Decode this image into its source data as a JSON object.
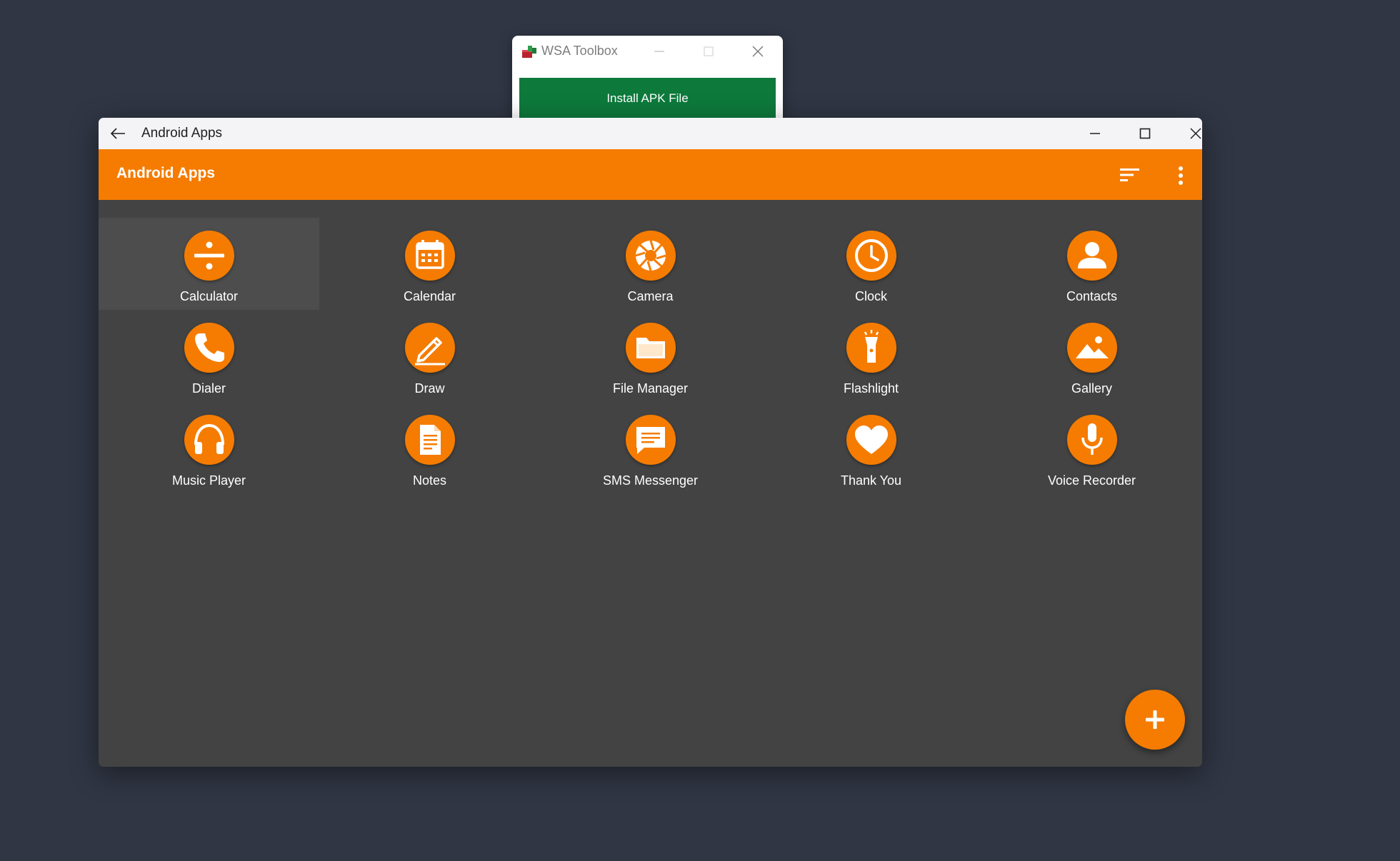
{
  "wsa_toolbox": {
    "title": "WSA Toolbox",
    "install_button": "Install APK File"
  },
  "window": {
    "title": "Android Apps"
  },
  "appbar": {
    "title": "Android Apps"
  },
  "apps": [
    {
      "label": "Calculator",
      "icon": "calculator-icon"
    },
    {
      "label": "Calendar",
      "icon": "calendar-icon"
    },
    {
      "label": "Camera",
      "icon": "camera-aperture-icon"
    },
    {
      "label": "Clock",
      "icon": "clock-icon"
    },
    {
      "label": "Contacts",
      "icon": "person-icon"
    },
    {
      "label": "Dialer",
      "icon": "phone-icon"
    },
    {
      "label": "Draw",
      "icon": "pencil-icon"
    },
    {
      "label": "File Manager",
      "icon": "folder-icon"
    },
    {
      "label": "Flashlight",
      "icon": "flashlight-icon"
    },
    {
      "label": "Gallery",
      "icon": "image-icon"
    },
    {
      "label": "Music Player",
      "icon": "headphones-icon"
    },
    {
      "label": "Notes",
      "icon": "document-icon"
    },
    {
      "label": "SMS Messenger",
      "icon": "message-icon"
    },
    {
      "label": "Thank You",
      "icon": "heart-icon"
    },
    {
      "label": "Voice Recorder",
      "icon": "microphone-icon"
    }
  ],
  "colors": {
    "accent": "#f57c00",
    "content_bg": "#434343",
    "desktop_bg": "#303644",
    "install_green": "#0d7a3c"
  }
}
